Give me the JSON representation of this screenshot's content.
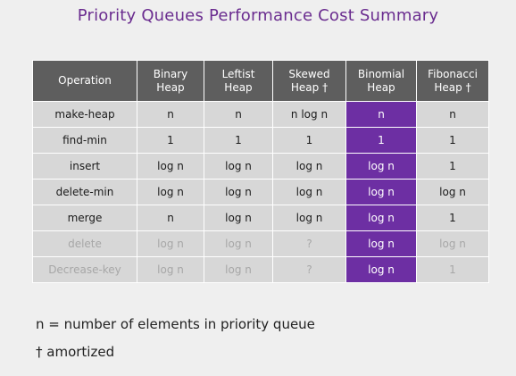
{
  "title": "Priority Queues Performance Cost Summary",
  "table": {
    "headers": [
      "Operation",
      "Binary\nHeap",
      "Leftist\nHeap",
      "Skewed\nHeap †",
      "Binomial\nHeap",
      "Fibonacci\nHeap †"
    ],
    "highlight_column": 4,
    "highlight_color": "#6d2fa3",
    "rows": [
      {
        "cells": [
          "make-heap",
          "n",
          "n",
          "n log n",
          "n",
          "n"
        ],
        "dim": false
      },
      {
        "cells": [
          "find-min",
          "1",
          "1",
          "1",
          "1",
          "1"
        ],
        "dim": false
      },
      {
        "cells": [
          "insert",
          "log n",
          "log n",
          "log n",
          "log n",
          "1"
        ],
        "dim": false
      },
      {
        "cells": [
          "delete-min",
          "log n",
          "log n",
          "log n",
          "log n",
          "log n"
        ],
        "dim": false
      },
      {
        "cells": [
          "merge",
          "n",
          "log n",
          "log n",
          "log n",
          "1"
        ],
        "dim": false
      },
      {
        "cells": [
          "delete",
          "log n",
          "log n",
          "?",
          "log n",
          "log n"
        ],
        "dim": true
      },
      {
        "cells": [
          "Decrease-key",
          "log n",
          "log n",
          "?",
          "log n",
          "1"
        ],
        "dim": true
      }
    ]
  },
  "notes": {
    "n_def": "n = number of elements in priority queue",
    "dagger_def": "† amortized"
  }
}
